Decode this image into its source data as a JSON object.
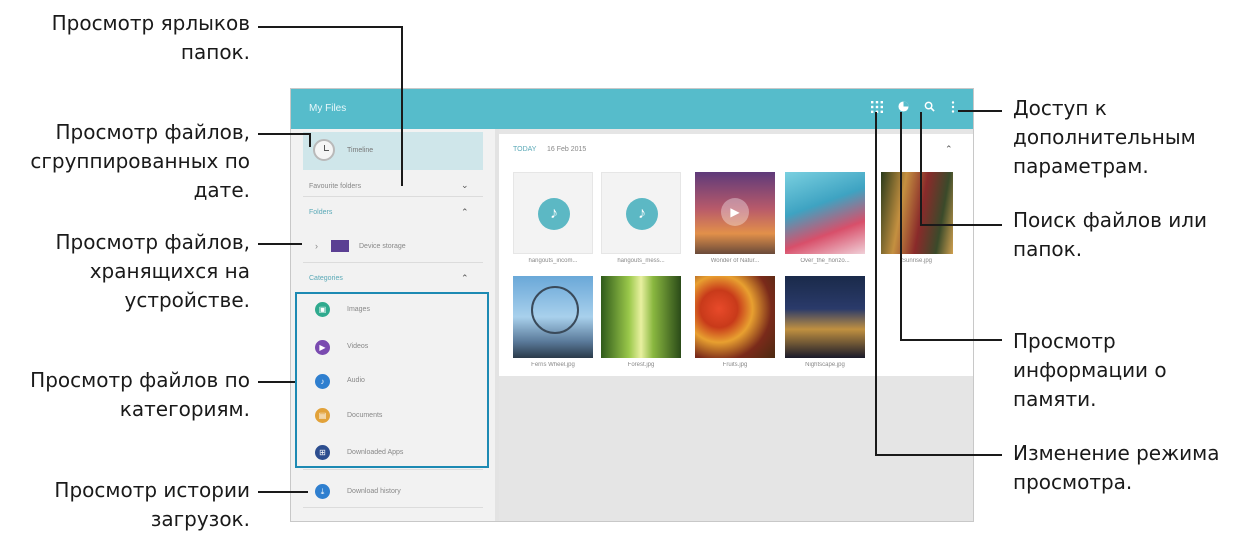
{
  "callouts": {
    "left": [
      {
        "lines": [
          "Просмотр ярлыков",
          "папок."
        ]
      },
      {
        "lines": [
          "Просмотр файлов,",
          "сгруппированных по",
          "дате."
        ]
      },
      {
        "lines": [
          "Просмотр файлов,",
          "хранящихся на",
          "устройстве."
        ]
      },
      {
        "lines": [
          "Просмотр файлов по",
          "категориям."
        ]
      },
      {
        "lines": [
          "Просмотр истории",
          "загрузок."
        ]
      }
    ],
    "right": [
      {
        "lines": [
          "Доступ к",
          "дополнительным",
          "параметрам."
        ]
      },
      {
        "lines": [
          "Поиск файлов или",
          "папок."
        ]
      },
      {
        "lines": [
          "Просмотр",
          "информации о",
          "памяти."
        ]
      },
      {
        "lines": [
          "Изменение режима",
          "просмотра."
        ]
      }
    ]
  },
  "app": {
    "title": "My Files",
    "toolbar": {
      "view_mode_icon": "grid-icon",
      "storage_icon": "pie-chart-icon",
      "search_icon": "search-icon",
      "more_icon": "more-vertical-icon"
    },
    "sidebar": {
      "timeline": "Timeline",
      "favourite_folders": "Favourite folders",
      "folders": "Folders",
      "device_storage": "Device storage",
      "categories": "Categories",
      "items": [
        {
          "label": "Images",
          "icon": "image-icon",
          "color": "#2faa8e"
        },
        {
          "label": "Videos",
          "icon": "video-icon",
          "color": "#7a4bb0"
        },
        {
          "label": "Audio",
          "icon": "music-note-icon",
          "color": "#2f7fcf"
        },
        {
          "label": "Documents",
          "icon": "document-icon",
          "color": "#e2a23a"
        },
        {
          "label": "Downloaded Apps",
          "icon": "apps-icon",
          "color": "#2d4e8f"
        }
      ],
      "download_history": "Download history",
      "download_history_color": "#2f7fcf"
    },
    "content": {
      "section": "TODAY",
      "date": "16 Feb 2015",
      "files": [
        {
          "name": "hangouts_incom..."
        },
        {
          "name": "hangouts_mess..."
        },
        {
          "name": "Wonder of Natur..."
        },
        {
          "name": "Over_the_horizo..."
        },
        {
          "name": "Sunrise.jpg"
        },
        {
          "name": "Ferris Wheel.jpg"
        },
        {
          "name": "Forest.jpg"
        },
        {
          "name": "Fruits.jpg"
        },
        {
          "name": "Nightscape.jpg"
        }
      ]
    },
    "accent_color": "#56bccb"
  }
}
